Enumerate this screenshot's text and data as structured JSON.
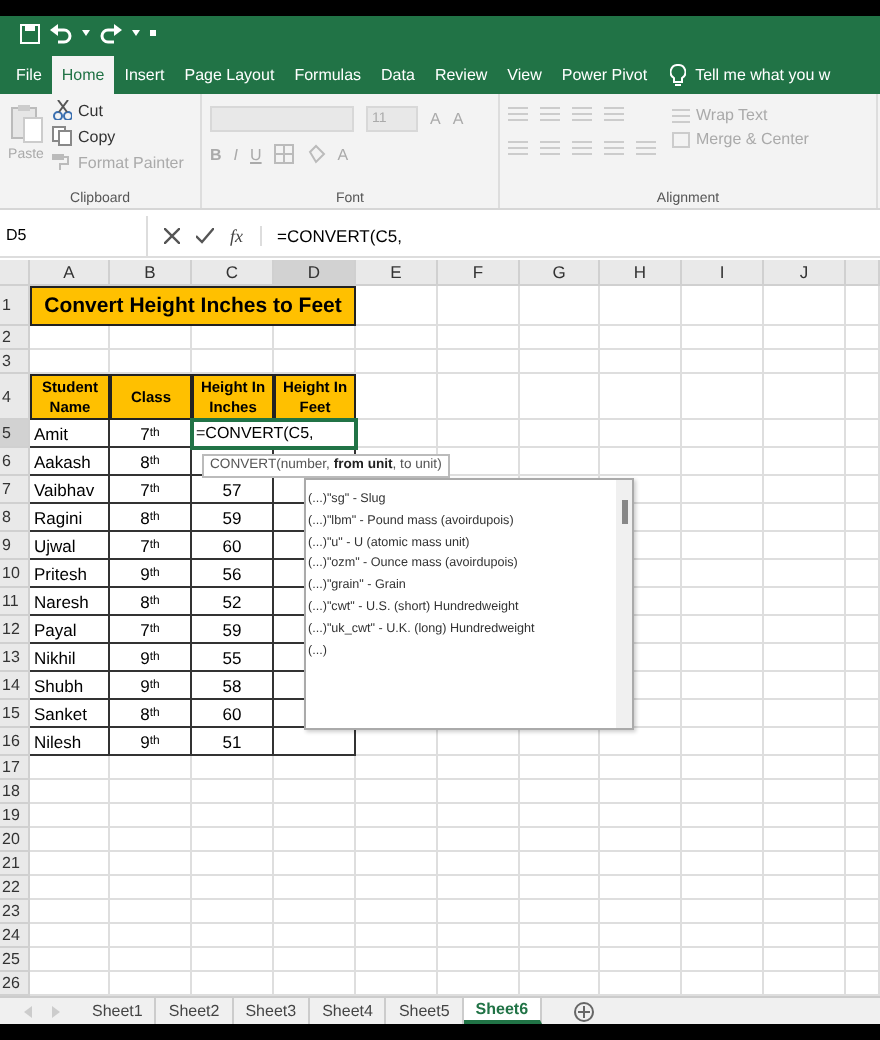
{
  "ribbon_tabs": [
    {
      "label": "File",
      "selected": false
    },
    {
      "label": "Home",
      "selected": true
    },
    {
      "label": "Insert",
      "selected": false
    },
    {
      "label": "Page Layout",
      "selected": false
    },
    {
      "label": "Formulas",
      "selected": false
    },
    {
      "label": "Data",
      "selected": false
    },
    {
      "label": "Review",
      "selected": false
    },
    {
      "label": "View",
      "selected": false
    },
    {
      "label": "Power Pivot",
      "selected": false
    }
  ],
  "tell_me": "Tell me what you w",
  "clipboard": {
    "label": "Clipboard",
    "items": [
      {
        "kind": "paste",
        "label": "Paste",
        "disabled": true
      },
      {
        "kind": "cut",
        "label": "Cut",
        "disabled": false
      },
      {
        "kind": "copy",
        "label": "Copy",
        "disabled": false
      },
      {
        "kind": "painter",
        "label": "Format Painter",
        "disabled": true
      }
    ]
  },
  "font": {
    "label": "Font",
    "size": "11",
    "disabled": true,
    "grow": "A",
    "shrink": "A",
    "bold": "B",
    "italic": "I",
    "underline": "U",
    "text_color_letter": "A"
  },
  "alignment": {
    "label": "Alignment",
    "disabled": true,
    "wrap_text": "Wrap Text",
    "merge_center": "Merge & Center"
  },
  "formula_bar": {
    "name_box": "D5",
    "fx": "fx",
    "formula": "=CONVERT(C5,"
  },
  "sheet": {
    "columns": [
      "A",
      "B",
      "C",
      "D",
      "E",
      "F",
      "G",
      "H",
      "I",
      "J"
    ],
    "row_numbers": [
      "1",
      "2",
      "3",
      "4",
      "5",
      "6",
      "7",
      "8",
      "9",
      "10",
      "11",
      "12",
      "13",
      "14",
      "15",
      "16",
      "17",
      "18",
      "19",
      "20",
      "21",
      "22",
      "23",
      "24",
      "25",
      "26"
    ],
    "title": "Convert Height Inches to Feet",
    "headers": [
      "Student Name",
      "Class",
      "Height In Inches",
      "Height In Feet"
    ],
    "rows": [
      {
        "name": "Amit",
        "class": "7$^{th}$",
        "inches": "=CONVERT(C5,",
        "editing": true
      },
      {
        "name": "Aakash",
        "class": "8$^{th}$",
        "editing": false
      },
      {
        "name": "Vaibhav",
        "class": "7$^{th}$",
        "inches": "57",
        "editing": false
      },
      {
        "name": "Ragini",
        "class": "8$^{th}$",
        "inches": "59",
        "editing": false
      },
      {
        "name": "Ujwal",
        "class": "7$^{th}$",
        "inches": "60",
        "editing": false
      },
      {
        "name": "Pritesh",
        "class": "9$^{th}$",
        "inches": "56",
        "editing": false
      },
      {
        "name": "Naresh",
        "class": "8$^{th}$",
        "inches": "52",
        "editing": false
      },
      {
        "name": "Payal",
        "class": "7$^{th}$",
        "inches": "59",
        "editing": false
      },
      {
        "name": "Nikhil",
        "class": "9$^{th}$",
        "inches": "55",
        "editing": false
      },
      {
        "name": "Shubh",
        "class": "9$^{th}$",
        "inches": "58",
        "editing": false
      },
      {
        "name": "Sanket",
        "class": "8$^{th}$",
        "inches": "60",
        "editing": false
      },
      {
        "name": "Nilesh",
        "class": "9$^{th}$",
        "inches": "51",
        "editing": false
      }
    ]
  },
  "tooltip": "CONVERT(number, **from unit**, to unit)",
  "autocomplete": [
    "(...)\"sg\" - Slug",
    "(...)\"lbm\" - Pound mass (avoirdupois)",
    "(...)\"u\" - U (atomic mass unit)",
    "(...)\"ozm\" - Ounce mass (avoirdupois)",
    "(...)\"grain\" - Grain",
    "(...)\"cwt\" - U.S. (short) Hundredweight",
    "(...)\"uk_cwt\" - U.K. (long) Hundredweight",
    "(...)"
  ],
  "sheet_tabs": [
    {
      "label": "Sheet1",
      "selected": false
    },
    {
      "label": "Sheet2",
      "selected": false
    },
    {
      "label": "Sheet3",
      "selected": false
    },
    {
      "label": "Sheet4",
      "selected": false
    },
    {
      "label": "Sheet5",
      "selected": false
    },
    {
      "label": "Sheet6",
      "selected": true
    }
  ]
}
